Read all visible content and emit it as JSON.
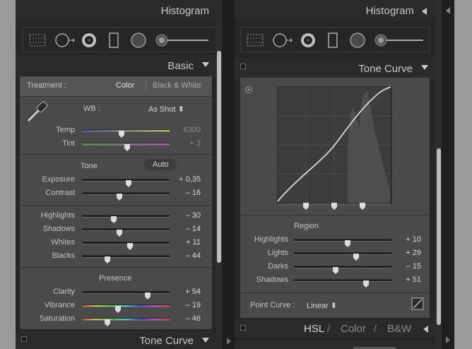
{
  "left_panel": {
    "histogram_title": "Histogram",
    "basic_title": "Basic",
    "treatment_label": "Treatment :",
    "treatment_color": "Color",
    "treatment_bw": "Black & White",
    "wb_label": "WB :",
    "wb_value": "As Shot ⬍",
    "temp": {
      "label": "Temp",
      "value": "6300",
      "level": 0.45
    },
    "tint": {
      "label": "Tint",
      "value": "+ 3",
      "level": 0.52
    },
    "tone_label": "Tone",
    "auto_label": "Auto",
    "sliders_tone": [
      {
        "label": "Exposure",
        "value": "+ 0,35",
        "level": 0.53
      },
      {
        "label": "Contrast",
        "value": "– 16",
        "level": 0.43
      }
    ],
    "sliders_hs": [
      {
        "label": "Highlights",
        "value": "– 30",
        "level": 0.36
      },
      {
        "label": "Shadows",
        "value": "– 14",
        "level": 0.43
      },
      {
        "label": "Whites",
        "value": "+ 11",
        "level": 0.55
      },
      {
        "label": "Blacks",
        "value": "– 44",
        "level": 0.29
      }
    ],
    "presence_label": "Presence",
    "sliders_presence": [
      {
        "label": "Clarity",
        "value": "+ 54",
        "level": 0.75
      },
      {
        "label": "Vibrance",
        "value": "– 19",
        "level": 0.41
      },
      {
        "label": "Saturation",
        "value": "– 46",
        "level": 0.29
      }
    ],
    "tone_curve_footer": "Tone Curve"
  },
  "right_panel": {
    "histogram_title": "Histogram",
    "tone_curve_title": "Tone Curve",
    "region_label": "Region",
    "sliders_region": [
      {
        "label": "Highlights",
        "value": "+ 10",
        "level": 0.55
      },
      {
        "label": "Lights",
        "value": "+ 29",
        "level": 0.64
      },
      {
        "label": "Darks",
        "value": "– 15",
        "level": 0.43
      },
      {
        "label": "Shadows",
        "value": "+ 51",
        "level": 0.74
      }
    ],
    "point_curve_label": "Point Curve :",
    "point_curve_value": "Linear ⬍",
    "hsl_label": "HSL",
    "color_label": "Color",
    "bw_label": "B&W",
    "hsl_sep": "/"
  },
  "colors": {
    "panel_bg": "#262626",
    "section_bg": "#4a4a4a",
    "text": "#c3c3c3",
    "value_text": "#d8d8d8"
  }
}
